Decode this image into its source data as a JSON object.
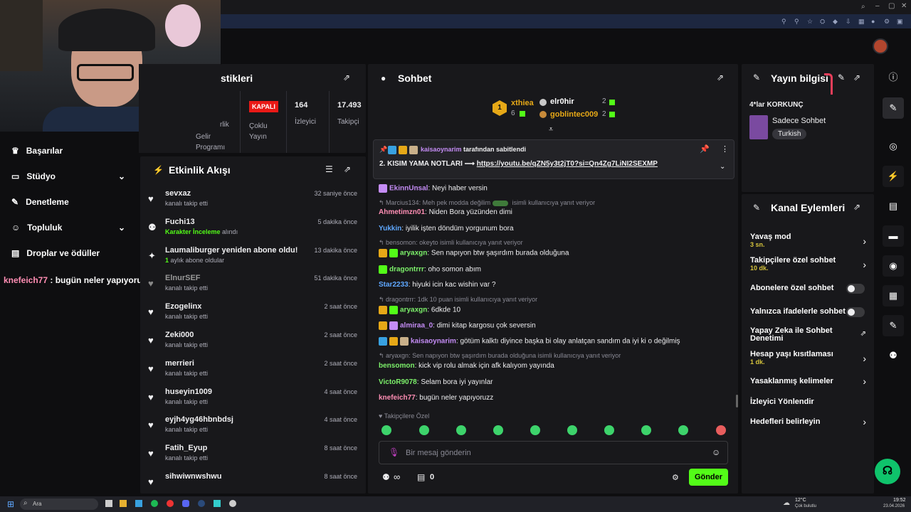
{
  "browser": {
    "tab_icons": [
      "search-icon",
      "minimize-icon",
      "window-icon",
      "close-icon"
    ]
  },
  "stats": {
    "title": "stikleri",
    "items": [
      {
        "label": "Gelir Programı",
        "partial": "rlik"
      },
      {
        "badge": "KAPALI",
        "label": "Çoklu Yayın"
      },
      {
        "value": "164",
        "label": "İzleyici"
      },
      {
        "value": "17.493",
        "label": "Takipçi"
      }
    ]
  },
  "side_menu": {
    "items": [
      {
        "label": "Başarılar",
        "icon": "trophy-icon"
      },
      {
        "label": "Stüdyo",
        "icon": "studio-icon",
        "chevron": true
      },
      {
        "label": "Denetleme",
        "icon": "wrench-icon"
      },
      {
        "label": "Topluluk",
        "icon": "people-icon",
        "chevron": true
      },
      {
        "label": "Droplar ve ödüller",
        "icon": "gift-icon"
      }
    ]
  },
  "overlay_chat": {
    "user": "knefeich77",
    "text": " : bugün neler yapıyoruzz"
  },
  "activity": {
    "title": "Etkinlik Akışı",
    "items": [
      {
        "name": "sevxaz",
        "sub": "kanalı takip etti",
        "time": "32 saniye önce",
        "icon": "heart"
      },
      {
        "name": "Fuchi13",
        "sub_hl": "Karakter İnceleme",
        "sub": " alındı",
        "time": "5 dakika önce",
        "icon": "points"
      },
      {
        "name": "Laumaliburger yeniden abone oldu!",
        "sub_hl": "1",
        "sub": " aylık abone oldular",
        "time": "13 dakika önce",
        "icon": "star"
      },
      {
        "name": "ElnurSEF",
        "sub": "kanalı takip etti",
        "time": "51 dakika önce",
        "icon": "heart"
      },
      {
        "name": "Ezogelinx",
        "sub": "kanalı takip etti",
        "time": "2 saat önce",
        "icon": "heart"
      },
      {
        "name": "Zeki000",
        "sub": "kanalı takip etti",
        "time": "2 saat önce",
        "icon": "heart"
      },
      {
        "name": "merrieri",
        "sub": "kanalı takip etti",
        "time": "2 saat önce",
        "icon": "heart"
      },
      {
        "name": "huseyin1009",
        "sub": "kanalı takip etti",
        "time": "4 saat önce",
        "icon": "heart"
      },
      {
        "name": "eyjh4yg46hbnbdsj",
        "sub": "kanalı takip etti",
        "time": "4 saat önce",
        "icon": "heart"
      },
      {
        "name": "Fatih_Eyup",
        "sub": "kanalı takip etti",
        "time": "8 saat önce",
        "icon": "heart"
      },
      {
        "name": "sihwiwnwshwu",
        "sub": "",
        "time": "8 saat önce",
        "icon": "heart"
      }
    ]
  },
  "chat": {
    "title": "Sohbet",
    "leaderboard": [
      {
        "rank": "1",
        "name": "xthiea",
        "count": "6"
      },
      {
        "rank": "2",
        "name": "elr0hir",
        "count": "2"
      },
      {
        "rank": "3",
        "name": "goblintec009",
        "count": "2"
      }
    ],
    "pinned": {
      "by": "kaisaoynarim",
      "by_suffix": " tarafından sabitlendi",
      "text": "2. KISIM YAMA NOTLARI ⟶ ",
      "link": "https://youtu.be/qZN5y3t2jT0?si=Qn4Zg7LiNI2SEXMP"
    },
    "messages": [
      {
        "user": "EkinnUnsal",
        "color": "#c48cf5",
        "text": "Neyi haber versin"
      },
      {
        "reply": "Marcius134: Meh pek modda değilim",
        "reply_suffix": " isimli kullanıcıya yanıt veriyor"
      },
      {
        "user": "Ahmetimzn01",
        "color": "#ff8eb4",
        "text": "Niden Bora yüzünden dimi"
      },
      {
        "user": "Yukkin",
        "color": "#5fa8ff",
        "text": "iyilik işten döndüm yorgunum bora"
      },
      {
        "reply": "bensomon: okeyto isimli kullanıcıya yanıt veriyor"
      },
      {
        "user": "aryaxgn",
        "color": "#7cf06a",
        "text": "Sen napıyon btw şaşırdım burada olduğuna"
      },
      {
        "user": "dragontrrr",
        "color": "#7cf06a",
        "text": "oho somon abım"
      },
      {
        "user": "Star2233",
        "color": "#5fa8ff",
        "text": "hiyuki icin kac wishin var ?"
      },
      {
        "reply": "dragontrrr: 1dk 10 puan isimli kullanıcıya yanıt veriyor"
      },
      {
        "user": "aryaxgn",
        "color": "#7cf06a",
        "text": "6dkde 10"
      },
      {
        "user": "almiraa_0",
        "color": "#c48cf5",
        "text": "dimi kitap kargosu çok seversin"
      },
      {
        "user": "kaisaoynarim",
        "color": "#c48cf5",
        "text": "götüm kalktı diyince başka bi olay anlatçan sandım da iyi ki o değilmiş"
      },
      {
        "reply": "aryaxgn: Sen napıyon btw şaşırdım burada olduğuna isimli kullanıcıya yanıt veriyor"
      },
      {
        "user": "bensomon",
        "color": "#7cf06a",
        "text": "kick vip rolu almak için afk kalıyom yayında"
      },
      {
        "user": "VictoR9078",
        "color": "#7cf06a",
        "text": "Selam bora iyi yayınlar"
      },
      {
        "user": "knefeich77",
        "color": "#ff8eb4",
        "text": "bugün neler yapıyoruzz"
      }
    ],
    "followers_only": "Takipçilere Özel",
    "input_placeholder": "Bir mesaj gönderin",
    "points": "∞",
    "store_count": "0",
    "send": "Gönder"
  },
  "stream_info": {
    "title": "Yayın bilgisi",
    "stream_title": "4*lar KORKUNÇ",
    "category": "Sadece Sohbet",
    "tag": "Turkish"
  },
  "channel_actions": {
    "title": "Kanal Eylemleri",
    "items": [
      {
        "label": "Yavaş mod",
        "sub": "3 sn.",
        "type": "chevron"
      },
      {
        "label": "Takipçilere özel sohbet",
        "sub": "10 dk.",
        "type": "chevron"
      },
      {
        "label": "Abonelere özel sohbet",
        "type": "toggle"
      },
      {
        "label": "Yalnızca ifadelerle sohbet",
        "type": "toggle"
      },
      {
        "label": "Yapay Zeka ile Sohbet Denetimi",
        "type": "external"
      },
      {
        "label": "Hesap yaşı kısıtlaması",
        "sub": "1 dk.",
        "type": "chevron"
      },
      {
        "label": "Yasaklanmış kelimeler",
        "type": "chevron"
      },
      {
        "label": "İzleyici Yönlendir",
        "type": "none"
      },
      {
        "label": "Hedefleri belirleyin",
        "type": "chevron"
      }
    ]
  },
  "taskbar": {
    "search": "Ara",
    "weather": "12°C",
    "weather_sub": "Çok bulutlu",
    "time": "19:52",
    "date": "23.04.2026"
  },
  "colors": {
    "accent": "#53fc18",
    "panel": "#18181b",
    "bg": "#0e0e10"
  }
}
